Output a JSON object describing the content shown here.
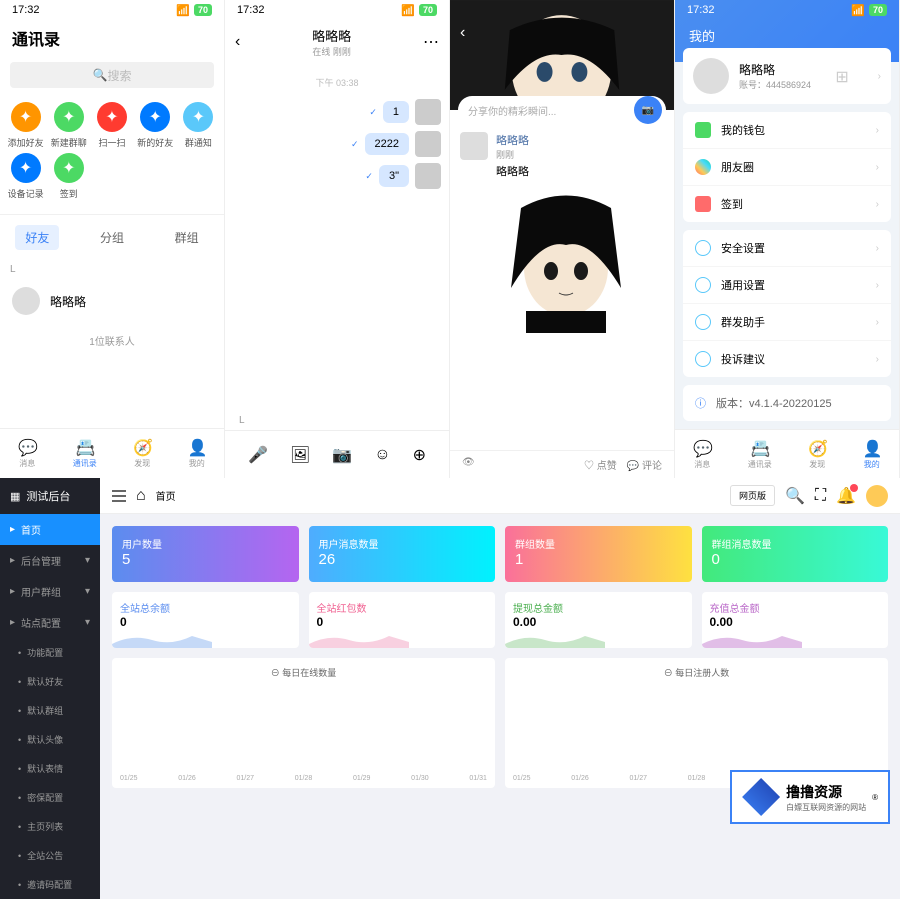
{
  "status": {
    "time": "17:32",
    "battery": "70"
  },
  "p1": {
    "title": "通讯录",
    "search_placeholder": "搜索",
    "actions": [
      {
        "label": "添加好友",
        "color": "ico-orange"
      },
      {
        "label": "新建群聊",
        "color": "ico-green"
      },
      {
        "label": "扫一扫",
        "color": "ico-red"
      },
      {
        "label": "新的好友",
        "color": "ico-blue"
      },
      {
        "label": "群通知",
        "color": "ico-teal"
      },
      {
        "label": "设备记录",
        "color": "ico-blue"
      },
      {
        "label": "签到",
        "color": "ico-green"
      }
    ],
    "tabs": [
      "好友",
      "分组",
      "群组"
    ],
    "letter": "L",
    "contact": "略略略",
    "count": "1位联系人"
  },
  "p2": {
    "name": "略略略",
    "status": "在线 刚刚",
    "time": "下午 03:38",
    "messages": [
      "1",
      "2222",
      "3\""
    ],
    "letter": "L"
  },
  "p3": {
    "share_placeholder": "分享你的精彩瞬间...",
    "post_name": "略略略",
    "post_time": "刚刚",
    "post_text": "略略略",
    "like": "点赞",
    "comment": "评论"
  },
  "p4": {
    "title": "我的",
    "name": "略略略",
    "account": "账号：444586924",
    "menu1": [
      "我的钱包",
      "朋友圈",
      "签到"
    ],
    "menu2": [
      "安全设置",
      "通用设置",
      "群发助手",
      "投诉建议"
    ],
    "version": "版本：v4.1.4-20220125"
  },
  "tabbar": [
    "消息",
    "通讯录",
    "发现",
    "我的"
  ],
  "admin": {
    "logo": "测试后台",
    "nav": [
      "首页",
      "后台管理",
      "用户群组",
      "站点配置"
    ],
    "subnav": [
      "功能配置",
      "默认好友",
      "默认群组",
      "默认头像",
      "默认表情",
      "密保配置",
      "主页列表",
      "全站公告",
      "邀请码配置"
    ],
    "breadcrumb": "首页",
    "view_mode": "网页版",
    "stats": [
      {
        "label": "用户数量",
        "value": "5"
      },
      {
        "label": "用户消息数量",
        "value": "26"
      },
      {
        "label": "群组数量",
        "value": "1"
      },
      {
        "label": "群组消息数量",
        "value": "0"
      }
    ],
    "metrics": [
      {
        "label": "全站总余额",
        "value": "0"
      },
      {
        "label": "全站红包数",
        "value": "0"
      },
      {
        "label": "提现总金额",
        "value": "0.00"
      },
      {
        "label": "充值总金额",
        "value": "0.00"
      }
    ],
    "charts": [
      "每日在线数量",
      "每日注册人数"
    ],
    "axis": [
      "01/25",
      "01/26",
      "01/27",
      "01/28",
      "01/29",
      "01/30",
      "01/31"
    ]
  },
  "watermark": {
    "title": "撸撸资源",
    "sub": "白嫖互联网资源的网站"
  }
}
